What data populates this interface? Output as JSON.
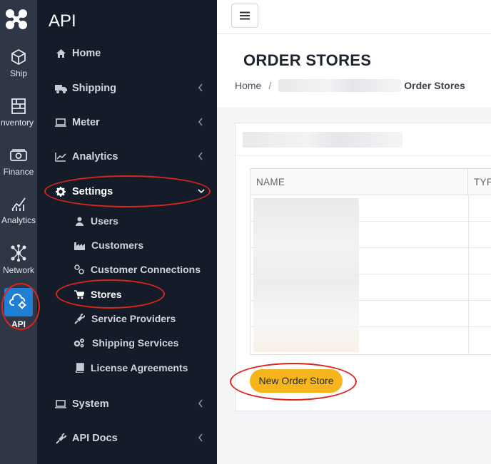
{
  "rail": {
    "items": [
      {
        "label": "Ship",
        "icon": "box-icon"
      },
      {
        "label": "nventory",
        "icon": "shelves-icon"
      },
      {
        "label": "Finance",
        "icon": "money-icon"
      },
      {
        "label": "Analytics",
        "icon": "chart-icon"
      },
      {
        "label": "Network",
        "icon": "network-icon"
      },
      {
        "label": "API",
        "icon": "cloud-gear-icon"
      }
    ]
  },
  "menu": {
    "title": "API",
    "items": [
      {
        "label": "Home"
      },
      {
        "label": "Shipping"
      },
      {
        "label": "Meter"
      },
      {
        "label": "Analytics"
      },
      {
        "label": "Settings"
      },
      {
        "label": "System"
      },
      {
        "label": "API Docs"
      }
    ],
    "settings_sub": [
      {
        "label": "Users"
      },
      {
        "label": "Customers"
      },
      {
        "label": "Customer Connections"
      },
      {
        "label": "Stores"
      },
      {
        "label": "Service Providers"
      },
      {
        "label": "Shipping Services"
      },
      {
        "label": "License Agreements"
      }
    ]
  },
  "page": {
    "title": "ORDER STORES",
    "breadcrumb": {
      "home": "Home",
      "sep": "/",
      "current": "Order Stores"
    }
  },
  "table": {
    "columns": [
      "NAME",
      "TYP"
    ]
  },
  "actions": {
    "new_label": "New Order Store"
  },
  "colors": {
    "accent": "#f6b51c",
    "highlight_ring": "#d9251c",
    "active_rail": "#1f7fd4"
  }
}
